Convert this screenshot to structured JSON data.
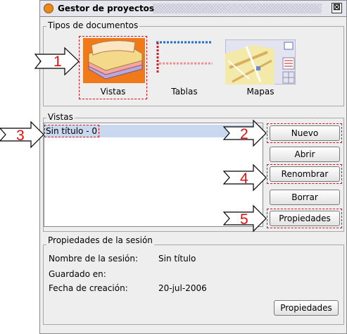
{
  "window": {
    "title": "Gestor de proyectos",
    "close_glyph": "⊠"
  },
  "doc_types": {
    "legend": "Tipos de documentos",
    "items": [
      {
        "label": "Vistas",
        "icon": "vistas-icon",
        "selected": true
      },
      {
        "label": "Tablas",
        "icon": "tablas-icon",
        "selected": false
      },
      {
        "label": "Mapas",
        "icon": "mapas-icon",
        "selected": false
      }
    ]
  },
  "vistas": {
    "legend": "Vistas",
    "list": [
      "Sin título - 0"
    ],
    "selected_index": 0,
    "buttons": {
      "new": "Nuevo",
      "open": "Abrir",
      "rename": "Renombrar",
      "delete": "Borrar",
      "properties": "Propiedades"
    }
  },
  "session": {
    "legend": "Propiedades de la sesión",
    "name_label": "Nombre de la sesión:",
    "name_value": "Sin título",
    "saved_label": "Guardado en:",
    "saved_value": "",
    "created_label": "Fecha de creación:",
    "created_value": "20-jul-2006",
    "properties_button": "Propiedades"
  },
  "callouts": [
    "1",
    "2",
    "3",
    "4",
    "5"
  ],
  "colors": {
    "callout": "#e01010",
    "selection": "#c9d7ef",
    "window_bg": "#eeeeee"
  }
}
